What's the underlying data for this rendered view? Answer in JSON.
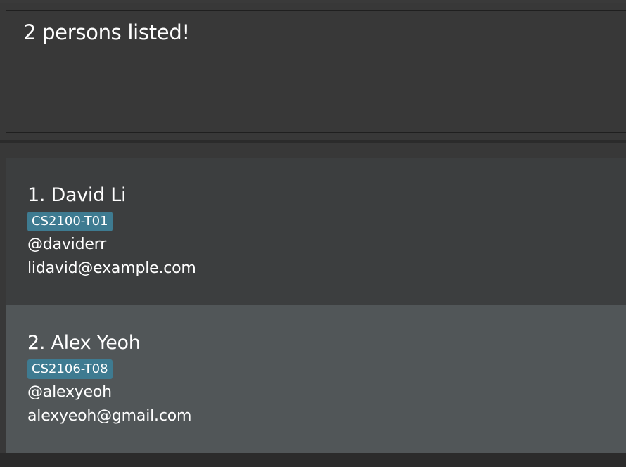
{
  "result": {
    "message": "2 persons listed!"
  },
  "persons": [
    {
      "index": "1.",
      "name": "David Li",
      "tag": "CS2100-T01",
      "handle": "@daviderr",
      "email": "lidavid@example.com"
    },
    {
      "index": "2.",
      "name": "Alex Yeoh",
      "tag": "CS2106-T08",
      "handle": "@alexyeoh",
      "email": "alexyeoh@gmail.com"
    }
  ],
  "colors": {
    "background": "#2b2b2b",
    "pane": "#383838",
    "card_odd": "#3c3e3f",
    "card_even": "#515658",
    "tag": "#3e7b91",
    "text": "#ffffff"
  }
}
